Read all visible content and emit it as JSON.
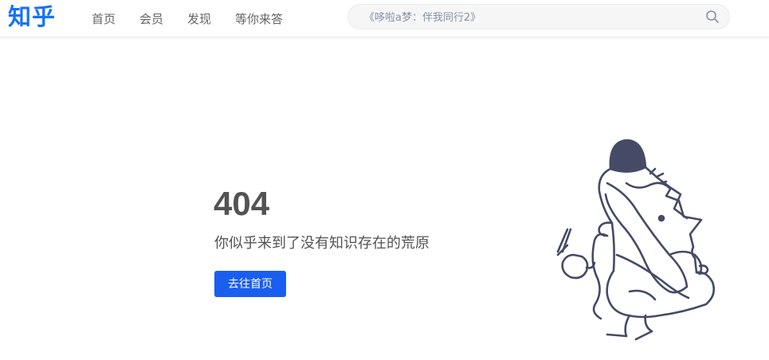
{
  "header": {
    "logo": "知乎",
    "nav": [
      {
        "label": "首页"
      },
      {
        "label": "会员"
      },
      {
        "label": "发现"
      },
      {
        "label": "等你来答"
      }
    ],
    "search": {
      "placeholder": "《哆啦a梦：伴我同行2》",
      "icon": "search-icon"
    }
  },
  "error": {
    "code": "404",
    "message": "你似乎来到了没有知识存在的荒原",
    "home_button": "去往首页"
  },
  "colors": {
    "brand": "#1772f6",
    "button": "#1a5ef0",
    "text": "#535353",
    "illustration": "#454b66"
  }
}
